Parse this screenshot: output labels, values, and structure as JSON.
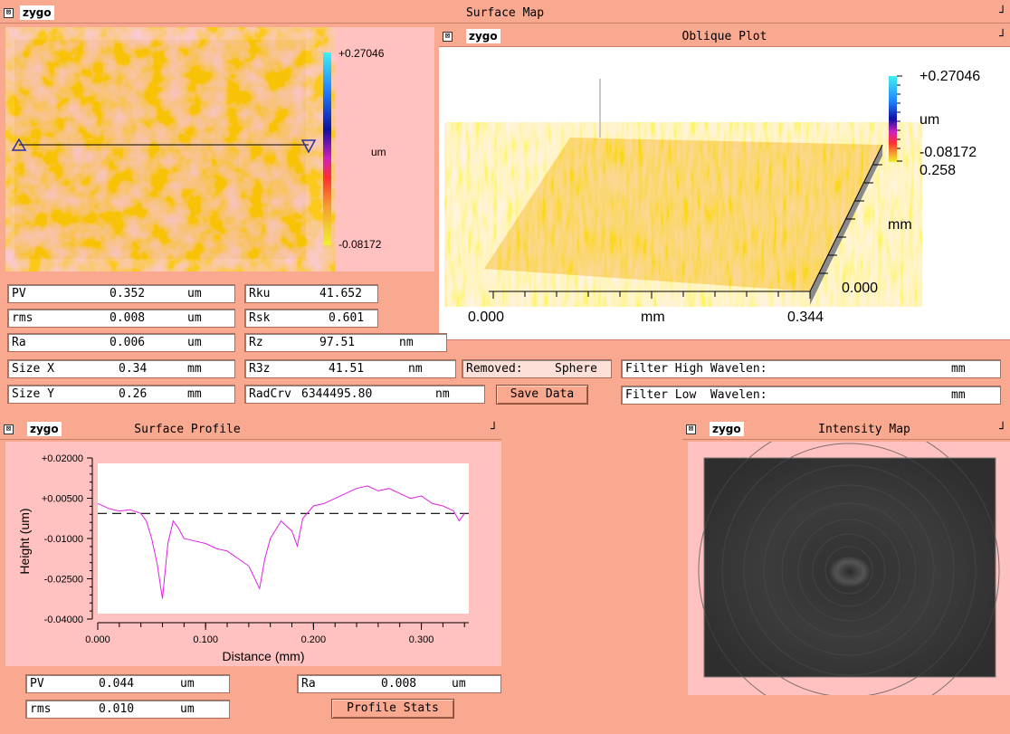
{
  "logo": "zygo",
  "windows": {
    "surface_map": "Surface Map",
    "oblique_plot": "Oblique Plot",
    "surface_profile": "Surface Profile",
    "intensity_map": "Intensity Map"
  },
  "surface_map_scale": {
    "max": "+0.27046",
    "unit": "um",
    "min": "-0.08172"
  },
  "oblique_scale": {
    "max": "+0.27046",
    "unit": "um",
    "min": "-0.08172",
    "y_max": "0.258",
    "y_unit": "mm",
    "y_min": "0.000",
    "x_min": "0.000",
    "x_unit": "mm",
    "x_max": "0.344"
  },
  "stats": {
    "pv": {
      "label": "PV",
      "value": "0.352",
      "unit": "um"
    },
    "rms": {
      "label": "rms",
      "value": "0.008",
      "unit": "um"
    },
    "ra": {
      "label": "Ra",
      "value": "0.006",
      "unit": "um"
    },
    "size_x": {
      "label": "Size X",
      "value": "0.34",
      "unit": "mm"
    },
    "size_y": {
      "label": "Size Y",
      "value": "0.26",
      "unit": "mm"
    },
    "rku": {
      "label": "Rku",
      "value": "41.652"
    },
    "rsk": {
      "label": "Rsk",
      "value": "0.601"
    },
    "rz": {
      "label": "Rz",
      "value": "97.51",
      "unit": "nm"
    },
    "r3z": {
      "label": "R3z",
      "value": "41.51",
      "unit": "nm"
    },
    "radcrv": {
      "label": "RadCrv",
      "value": "6344495.80",
      "unit": "nm"
    },
    "removed": {
      "label": "Removed:",
      "value": "Sphere"
    },
    "filter_high": {
      "label": "Filter High Wavelen:",
      "unit": "mm"
    },
    "filter_low": {
      "label": "Filter Low  Wavelen:",
      "unit": "mm"
    },
    "save_data": "Save Data"
  },
  "profile_stats": {
    "pv": {
      "label": "PV",
      "value": "0.044",
      "unit": "um"
    },
    "rms": {
      "label": "rms",
      "value": "0.010",
      "unit": "um"
    },
    "ra": {
      "label": "Ra",
      "value": "0.008",
      "unit": "um"
    },
    "button": "Profile Stats"
  },
  "chart_data": {
    "type": "line",
    "xlabel": "Distance (mm)",
    "ylabel": "Height (um)",
    "xlim": [
      0.0,
      0.344
    ],
    "ylim": [
      -0.04,
      0.02
    ],
    "x_ticks": [
      "0.000",
      "0.100",
      "0.200",
      "0.300"
    ],
    "y_ticks": [
      "+0.02000",
      "+0.00500",
      "-0.01000",
      "-0.02500",
      "-0.04000"
    ],
    "reference_line": 0.0,
    "series": [
      {
        "color": "#e020e0",
        "x": [
          0.0,
          0.01,
          0.02,
          0.03,
          0.04,
          0.045,
          0.05,
          0.055,
          0.06,
          0.065,
          0.07,
          0.075,
          0.08,
          0.09,
          0.1,
          0.11,
          0.12,
          0.13,
          0.14,
          0.15,
          0.155,
          0.16,
          0.17,
          0.18,
          0.185,
          0.19,
          0.2,
          0.21,
          0.22,
          0.23,
          0.24,
          0.25,
          0.26,
          0.27,
          0.28,
          0.29,
          0.3,
          0.31,
          0.32,
          0.33,
          0.335,
          0.34
        ],
        "y": [
          0.004,
          0.002,
          0.001,
          0.0015,
          0.0,
          -0.003,
          -0.01,
          -0.02,
          -0.034,
          -0.012,
          -0.003,
          -0.006,
          -0.01,
          -0.011,
          -0.012,
          -0.014,
          -0.015,
          -0.018,
          -0.021,
          -0.03,
          -0.018,
          -0.01,
          -0.003,
          -0.007,
          -0.013,
          -0.002,
          0.003,
          0.004,
          0.006,
          0.008,
          0.01,
          0.011,
          0.009,
          0.01,
          0.008,
          0.006,
          0.007,
          0.004,
          0.003,
          0.001,
          -0.003,
          0.0
        ]
      }
    ]
  },
  "colors": {
    "background": "#f8a98f",
    "panel": "#ffc2c0",
    "map_orange": "#f39a2a",
    "map_yellow": "#f4e63a",
    "profile_line": "#e020e0"
  }
}
